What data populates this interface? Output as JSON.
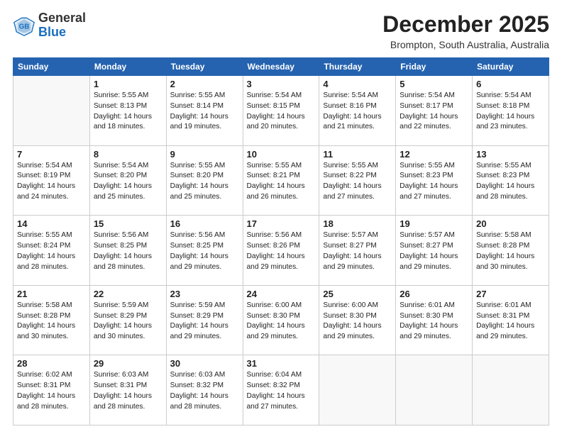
{
  "logo": {
    "general": "General",
    "blue": "Blue"
  },
  "title": "December 2025",
  "subtitle": "Brompton, South Australia, Australia",
  "weekdays": [
    "Sunday",
    "Monday",
    "Tuesday",
    "Wednesday",
    "Thursday",
    "Friday",
    "Saturday"
  ],
  "weeks": [
    [
      {
        "day": "",
        "detail": ""
      },
      {
        "day": "1",
        "detail": "Sunrise: 5:55 AM\nSunset: 8:13 PM\nDaylight: 14 hours\nand 18 minutes."
      },
      {
        "day": "2",
        "detail": "Sunrise: 5:55 AM\nSunset: 8:14 PM\nDaylight: 14 hours\nand 19 minutes."
      },
      {
        "day": "3",
        "detail": "Sunrise: 5:54 AM\nSunset: 8:15 PM\nDaylight: 14 hours\nand 20 minutes."
      },
      {
        "day": "4",
        "detail": "Sunrise: 5:54 AM\nSunset: 8:16 PM\nDaylight: 14 hours\nand 21 minutes."
      },
      {
        "day": "5",
        "detail": "Sunrise: 5:54 AM\nSunset: 8:17 PM\nDaylight: 14 hours\nand 22 minutes."
      },
      {
        "day": "6",
        "detail": "Sunrise: 5:54 AM\nSunset: 8:18 PM\nDaylight: 14 hours\nand 23 minutes."
      }
    ],
    [
      {
        "day": "7",
        "detail": "Sunrise: 5:54 AM\nSunset: 8:19 PM\nDaylight: 14 hours\nand 24 minutes."
      },
      {
        "day": "8",
        "detail": "Sunrise: 5:54 AM\nSunset: 8:20 PM\nDaylight: 14 hours\nand 25 minutes."
      },
      {
        "day": "9",
        "detail": "Sunrise: 5:55 AM\nSunset: 8:20 PM\nDaylight: 14 hours\nand 25 minutes."
      },
      {
        "day": "10",
        "detail": "Sunrise: 5:55 AM\nSunset: 8:21 PM\nDaylight: 14 hours\nand 26 minutes."
      },
      {
        "day": "11",
        "detail": "Sunrise: 5:55 AM\nSunset: 8:22 PM\nDaylight: 14 hours\nand 27 minutes."
      },
      {
        "day": "12",
        "detail": "Sunrise: 5:55 AM\nSunset: 8:23 PM\nDaylight: 14 hours\nand 27 minutes."
      },
      {
        "day": "13",
        "detail": "Sunrise: 5:55 AM\nSunset: 8:23 PM\nDaylight: 14 hours\nand 28 minutes."
      }
    ],
    [
      {
        "day": "14",
        "detail": "Sunrise: 5:55 AM\nSunset: 8:24 PM\nDaylight: 14 hours\nand 28 minutes."
      },
      {
        "day": "15",
        "detail": "Sunrise: 5:56 AM\nSunset: 8:25 PM\nDaylight: 14 hours\nand 28 minutes."
      },
      {
        "day": "16",
        "detail": "Sunrise: 5:56 AM\nSunset: 8:25 PM\nDaylight: 14 hours\nand 29 minutes."
      },
      {
        "day": "17",
        "detail": "Sunrise: 5:56 AM\nSunset: 8:26 PM\nDaylight: 14 hours\nand 29 minutes."
      },
      {
        "day": "18",
        "detail": "Sunrise: 5:57 AM\nSunset: 8:27 PM\nDaylight: 14 hours\nand 29 minutes."
      },
      {
        "day": "19",
        "detail": "Sunrise: 5:57 AM\nSunset: 8:27 PM\nDaylight: 14 hours\nand 29 minutes."
      },
      {
        "day": "20",
        "detail": "Sunrise: 5:58 AM\nSunset: 8:28 PM\nDaylight: 14 hours\nand 30 minutes."
      }
    ],
    [
      {
        "day": "21",
        "detail": "Sunrise: 5:58 AM\nSunset: 8:28 PM\nDaylight: 14 hours\nand 30 minutes."
      },
      {
        "day": "22",
        "detail": "Sunrise: 5:59 AM\nSunset: 8:29 PM\nDaylight: 14 hours\nand 30 minutes."
      },
      {
        "day": "23",
        "detail": "Sunrise: 5:59 AM\nSunset: 8:29 PM\nDaylight: 14 hours\nand 29 minutes."
      },
      {
        "day": "24",
        "detail": "Sunrise: 6:00 AM\nSunset: 8:30 PM\nDaylight: 14 hours\nand 29 minutes."
      },
      {
        "day": "25",
        "detail": "Sunrise: 6:00 AM\nSunset: 8:30 PM\nDaylight: 14 hours\nand 29 minutes."
      },
      {
        "day": "26",
        "detail": "Sunrise: 6:01 AM\nSunset: 8:30 PM\nDaylight: 14 hours\nand 29 minutes."
      },
      {
        "day": "27",
        "detail": "Sunrise: 6:01 AM\nSunset: 8:31 PM\nDaylight: 14 hours\nand 29 minutes."
      }
    ],
    [
      {
        "day": "28",
        "detail": "Sunrise: 6:02 AM\nSunset: 8:31 PM\nDaylight: 14 hours\nand 28 minutes."
      },
      {
        "day": "29",
        "detail": "Sunrise: 6:03 AM\nSunset: 8:31 PM\nDaylight: 14 hours\nand 28 minutes."
      },
      {
        "day": "30",
        "detail": "Sunrise: 6:03 AM\nSunset: 8:32 PM\nDaylight: 14 hours\nand 28 minutes."
      },
      {
        "day": "31",
        "detail": "Sunrise: 6:04 AM\nSunset: 8:32 PM\nDaylight: 14 hours\nand 27 minutes."
      },
      {
        "day": "",
        "detail": ""
      },
      {
        "day": "",
        "detail": ""
      },
      {
        "day": "",
        "detail": ""
      }
    ]
  ]
}
